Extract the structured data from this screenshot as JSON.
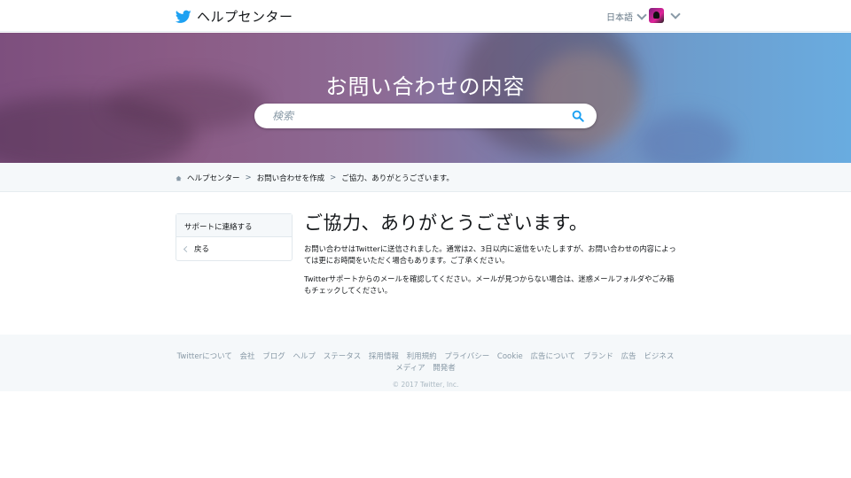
{
  "header": {
    "brand_title": "ヘルプセンター",
    "language": "日本語",
    "logo_icon": "twitter-bird-icon",
    "brand_color": "#1da1f2"
  },
  "hero": {
    "title": "お問い合わせの内容",
    "search_placeholder": "検索"
  },
  "breadcrumb": {
    "items": [
      "ヘルプセンター",
      "お問い合わせを作成",
      "ご協力、ありがとうございます。"
    ],
    "separator": ">"
  },
  "sidebar": {
    "heading": "サポートに連絡する",
    "back_label": "戻る"
  },
  "main": {
    "title": "ご協力、ありがとうございます。",
    "paragraph1": "お問い合わせはTwitterに送信されました。通常は2、3日以内に返信をいたしますが、お問い合わせの内容によっては更にお時間をいただく場合もあります。ご了承ください。",
    "paragraph2": "Twitterサポートからのメールを確認してください。メールが見つからない場合は、迷惑メールフォルダやごみ箱もチェックしてください。"
  },
  "footer": {
    "links": [
      "Twitterについて",
      "会社",
      "ブログ",
      "ヘルプ",
      "ステータス",
      "採用情報",
      "利用規約",
      "プライバシー",
      "Cookie",
      "広告について",
      "ブランド",
      "広告",
      "ビジネス",
      "メディア",
      "開発者"
    ],
    "copyright": "© 2017 Twitter, Inc."
  }
}
